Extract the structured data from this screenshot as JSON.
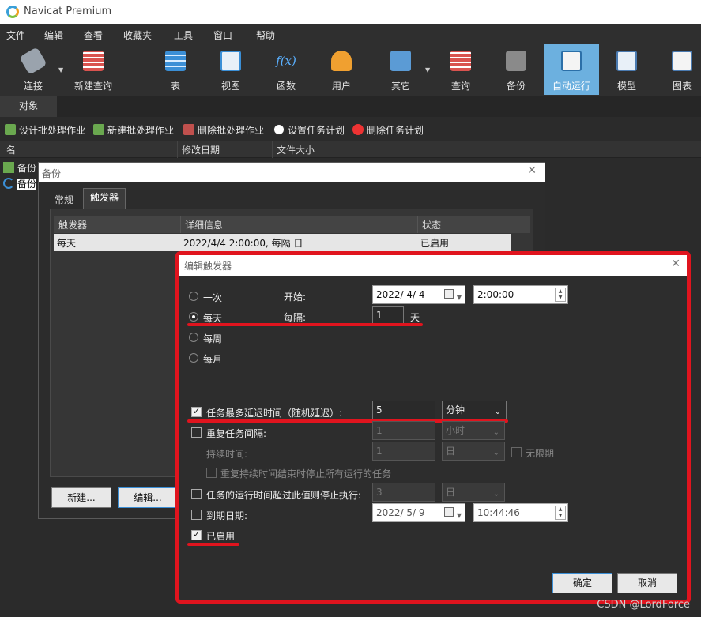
{
  "app": {
    "title": "Navicat Premium"
  },
  "menu": [
    "文件",
    "编辑",
    "查看",
    "收藏夹",
    "工具",
    "窗口",
    "帮助"
  ],
  "toolbar": [
    {
      "label": "连接",
      "icon": "plug-icon"
    },
    {
      "label": "新建查询",
      "icon": "new-query-icon"
    },
    {
      "label": "表",
      "icon": "table-icon"
    },
    {
      "label": "视图",
      "icon": "view-icon"
    },
    {
      "label": "函数",
      "icon": "function-icon",
      "glyph": "f(x)"
    },
    {
      "label": "用户",
      "icon": "user-icon"
    },
    {
      "label": "其它",
      "icon": "tools-icon"
    },
    {
      "label": "查询",
      "icon": "query-icon"
    },
    {
      "label": "备份",
      "icon": "backup-icon"
    },
    {
      "label": "自动运行",
      "icon": "automation-icon"
    },
    {
      "label": "模型",
      "icon": "model-icon"
    },
    {
      "label": "图表",
      "icon": "chart-icon"
    }
  ],
  "object_tab": "对象",
  "actions": [
    "设计批处理作业",
    "新建批处理作业",
    "删除批处理作业",
    "设置任务计划",
    "删除任务计划"
  ],
  "list": {
    "headers": [
      "名",
      "修改日期",
      "文件大小"
    ],
    "rows": [
      "备份",
      "备份"
    ]
  },
  "backup_dialog": {
    "title": "备份",
    "tabs": [
      "常规",
      "触发器"
    ],
    "table_headers": [
      "触发器",
      "详细信息",
      "状态"
    ],
    "rows": [
      {
        "trigger": "每天",
        "detail": "2022/4/4 2:00:00, 每隔 日",
        "status": "已启用"
      }
    ],
    "buttons": {
      "new": "新建...",
      "edit": "编辑..."
    }
  },
  "edit_trigger": {
    "title": "编辑触发器",
    "schedule": [
      "一次",
      "每天",
      "每周",
      "每月"
    ],
    "selected": "每天",
    "start_label": "开始:",
    "start_date": "2022/  4/  4",
    "start_time": "2:00:00",
    "interval_label": "每隔:",
    "interval_value": "1",
    "interval_unit": "天",
    "max_delay_label": "任务最多延迟时间（随机延迟）:",
    "max_delay_value": "5",
    "max_delay_unit": "分钟",
    "repeat_label": "重复任务间隔:",
    "repeat_value": "1",
    "repeat_unit": "小时",
    "duration_label": "持续时间:",
    "duration_value": "1",
    "duration_unit": "日",
    "unlimited_label": "无限期",
    "stop_all_label": "重复持续时间结束时停止所有运行的任务",
    "stop_exceed_label": "任务的运行时间超过此值则停止执行:",
    "stop_exceed_value": "3",
    "stop_exceed_unit": "日",
    "expire_label": "到期日期:",
    "expire_date": "2022/  5/  9",
    "expire_time": "10:44:46",
    "enabled_label": "已启用",
    "ok": "确定",
    "cancel": "取消"
  },
  "watermark": "CSDN @LordForce",
  "colors": {
    "highlight": "#e0141e",
    "active_tool": "#6cb0df"
  }
}
